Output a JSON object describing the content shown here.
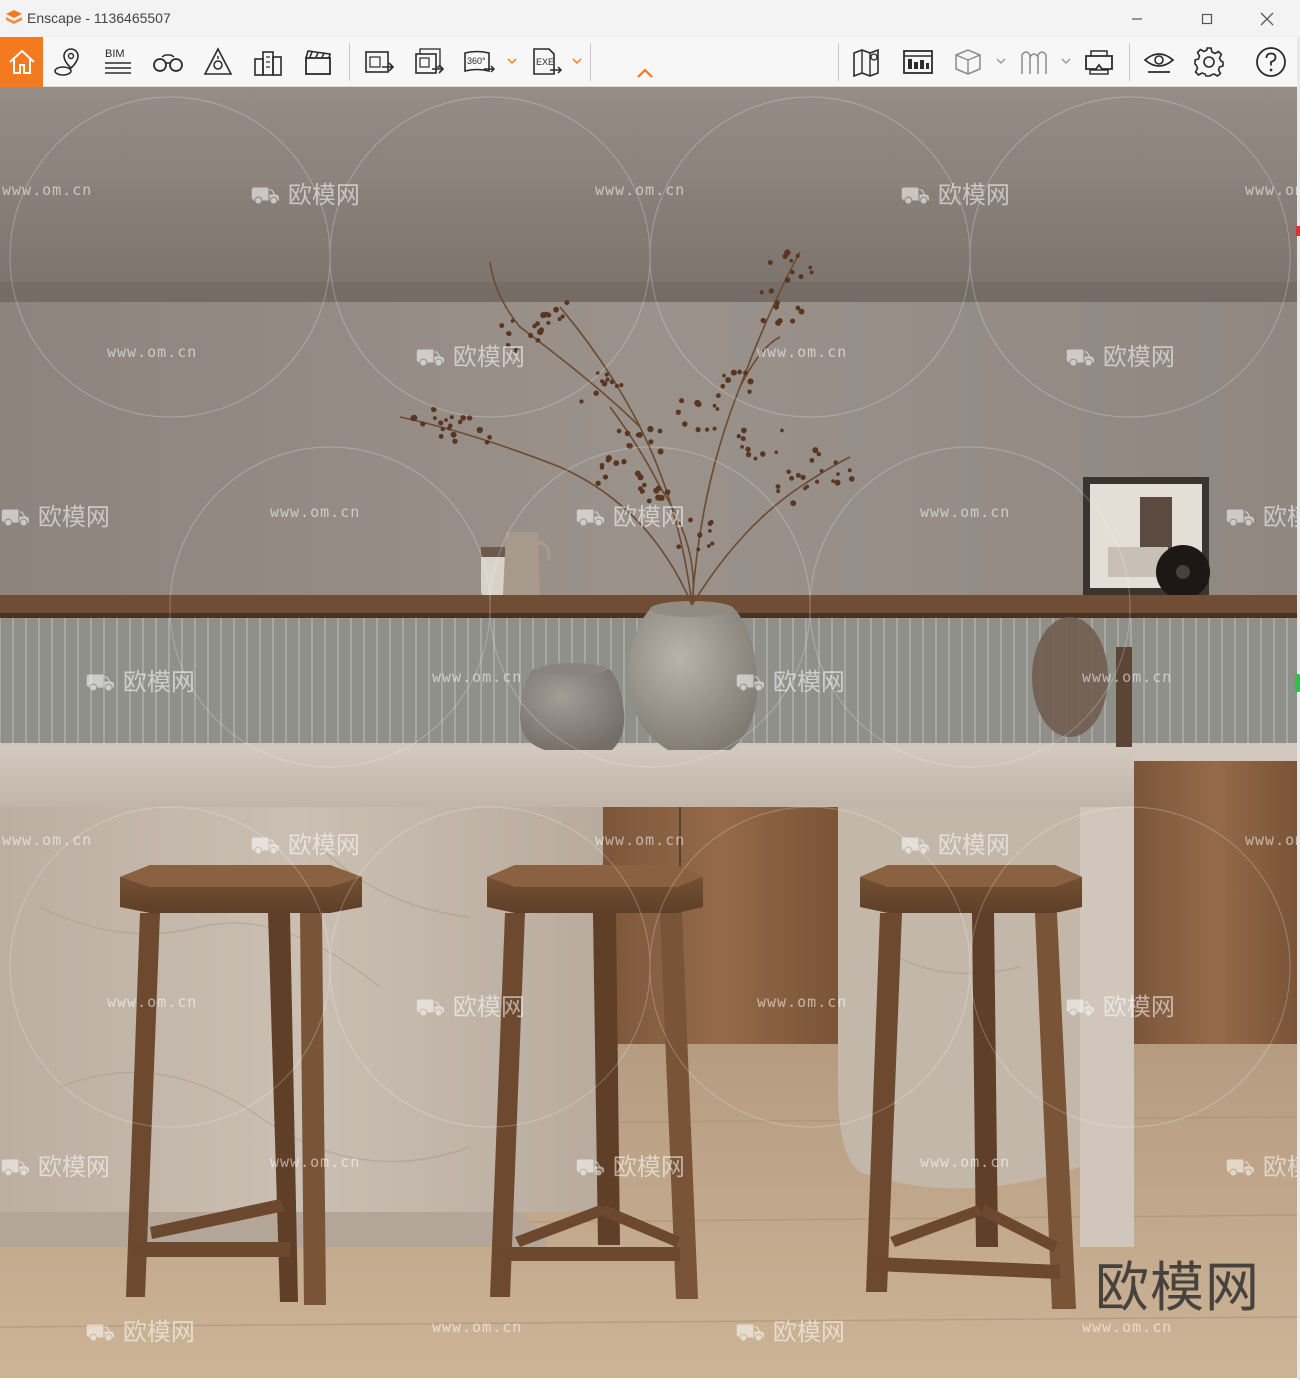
{
  "window": {
    "title": "Enscape - 1136465507",
    "accent_color": "#f47a20"
  },
  "toolbar": {
    "bim_label": "BIM",
    "pano_label": "360°",
    "exe_label": "EXE",
    "left_icons": [
      "home-icon",
      "location-pin-icon",
      "bim-icon",
      "binoculars-icon",
      "light-view-icon",
      "buildings-icon",
      "clapperboard-icon",
      "export-screenshot-icon",
      "batch-render-icon",
      "panorama-360-icon",
      "export-exe-icon"
    ],
    "right_icons": [
      "map-icon",
      "visual-presets-icon",
      "section-cube-icon",
      "asset-library-icon",
      "vr-headset-icon",
      "view-settings-eye-icon",
      "settings-gear-icon",
      "help-icon"
    ]
  },
  "watermark": {
    "site": "www.om.cn",
    "brand": "欧模网",
    "corner_mark": "欧模网"
  }
}
